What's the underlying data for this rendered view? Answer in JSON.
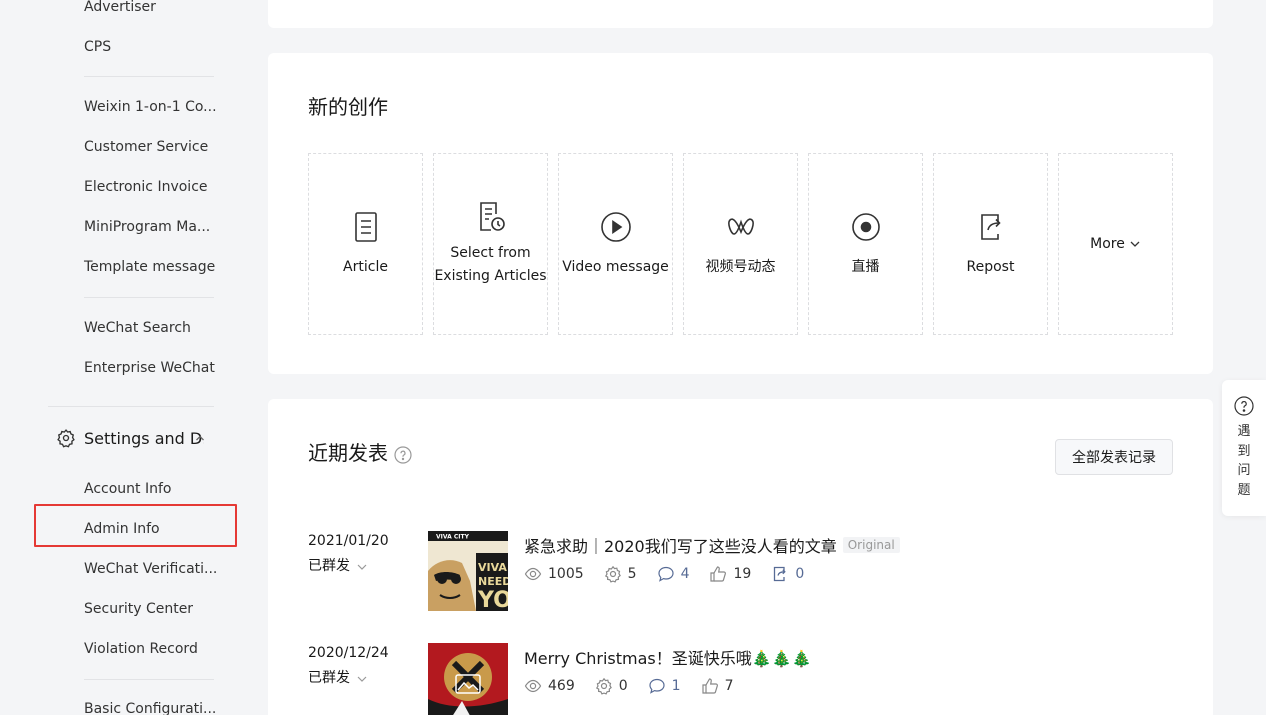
{
  "sidebar": {
    "items_top": [
      {
        "label": "Advertiser"
      },
      {
        "label": "CPS"
      }
    ],
    "items_group2": [
      {
        "label": "Weixin 1-on-1 Co..."
      },
      {
        "label": "Customer Service"
      },
      {
        "label": "Electronic Invoice"
      },
      {
        "label": "MiniProgram Ma..."
      },
      {
        "label": "Template message"
      }
    ],
    "items_group3": [
      {
        "label": "WeChat Search"
      },
      {
        "label": "Enterprise WeChat"
      }
    ],
    "settings_section": {
      "title": "Settings and D...",
      "icon": "gear-icon",
      "items": [
        {
          "label": "Account Info"
        },
        {
          "label": "Admin Info"
        },
        {
          "label": "WeChat Verificati..."
        },
        {
          "label": "Security Center"
        },
        {
          "label": "Violation Record"
        }
      ]
    },
    "items_bottom": [
      {
        "label": "Basic Configurati..."
      }
    ],
    "highlight_color": "#e53935"
  },
  "create": {
    "title": "新的创作",
    "tiles": [
      {
        "label": "Article",
        "icon": "article-icon"
      },
      {
        "label": "Select from Existing Articles",
        "icon": "select-article-icon"
      },
      {
        "label": "Video message",
        "icon": "play-icon"
      },
      {
        "label": "视频号动态",
        "icon": "channels-icon"
      },
      {
        "label": "直播",
        "icon": "live-icon"
      },
      {
        "label": "Repost",
        "icon": "repost-icon"
      },
      {
        "label": "More",
        "icon": "chevron-down-icon"
      }
    ]
  },
  "recent": {
    "title": "近期发表",
    "all_records_label": "全部发表记录",
    "posts": [
      {
        "date": "2021/01/20",
        "status": "已群发",
        "title": "紧急求助｜2020我们写了这些没人看的文章",
        "badge": "Original",
        "views": "1005",
        "shares": "5",
        "comments": "4",
        "likes": "19",
        "reposts": "0"
      },
      {
        "date": "2020/12/24",
        "status": "已群发",
        "title": "Merry Christmas！圣诞快乐哦🎄🎄🎄",
        "views": "469",
        "shares": "0",
        "comments": "1",
        "likes": "7"
      }
    ]
  },
  "help_float": {
    "text": "遇到问题",
    "icon": "question-icon"
  },
  "colors": {
    "link": "#576b95",
    "background": "#f4f5f7"
  }
}
